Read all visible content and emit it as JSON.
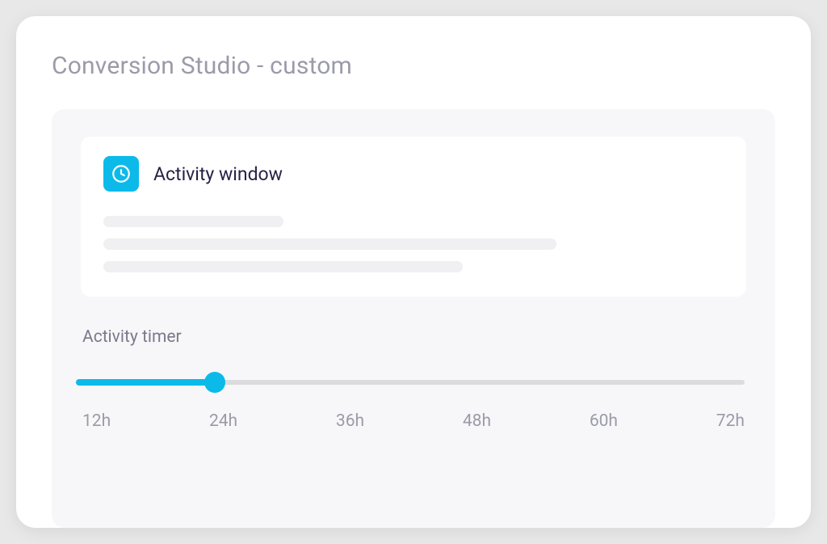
{
  "page": {
    "title": "Conversion Studio - custom"
  },
  "card": {
    "icon": "clock-icon",
    "title": "Activity window"
  },
  "timer": {
    "label": "Activity timer",
    "min": 12,
    "max": 72,
    "value": 24,
    "ticks": [
      "12h",
      "24h",
      "36h",
      "48h",
      "60h",
      "72h"
    ]
  },
  "colors": {
    "accent": "#0cbaea",
    "text_muted": "#9b9ba9",
    "text_dark": "#2a2144",
    "panel_bg": "#f7f7f9",
    "skeleton": "#f0f0f2",
    "track_bg": "#dcdcde"
  }
}
